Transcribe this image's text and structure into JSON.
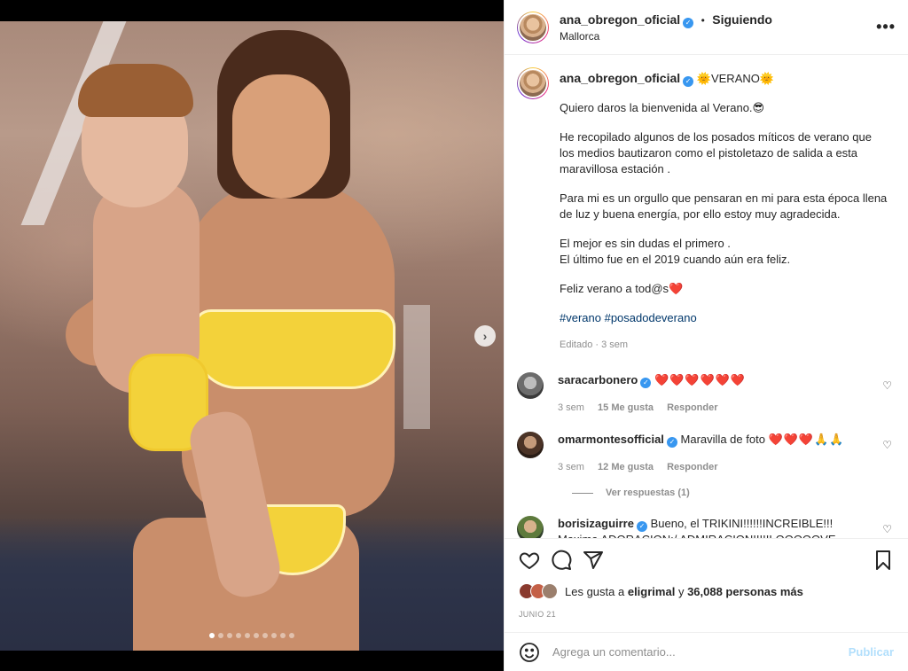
{
  "post": {
    "carousel_dots": 10,
    "active_dot": 0
  },
  "header": {
    "username": "ana_obregon_oficial",
    "separator": "•",
    "follow_status": "Siguiendo",
    "location": "Mallorca",
    "more_icon": "more-horizontal-icon"
  },
  "caption": {
    "username": "ana_obregon_oficial",
    "title": "🌞VERANO🌞",
    "paragraph_1": "Quiero daros la bienvenida al Verano.😎",
    "paragraph_2": "He recopilado algunos de los posados míticos de verano que los medios bautizaron como el pistoletazo de salida a esta maravillosa estación .",
    "paragraph_3": "Para mi es un orgullo que pensaran en mi para esta época llena de luz y buena energía, por ello estoy muy agradecida.",
    "paragraph_4a": "El mejor es sin dudas el primero .",
    "paragraph_4b": "El último fue en el 2019 cuando aún era feliz.",
    "paragraph_5": "Feliz verano a tod@s❤️",
    "hashtags": "#verano #posadodeverano",
    "meta": "Editado · 3 sem"
  },
  "comments": [
    {
      "username": "saracarbonero",
      "text": "❤️❤️❤️❤️❤️❤️",
      "age": "3 sem",
      "likes": "15 Me gusta",
      "reply": "Responder"
    },
    {
      "username": "omarmontesofficial",
      "text": "Maravilla de foto",
      "emoji": "❤️❤️❤️🙏🙏",
      "age": "3 sem",
      "likes": "12 Me gusta",
      "reply": "Responder",
      "view_replies": "Ver respuestas (1)"
    },
    {
      "username": "borisizaguirre",
      "text": "Bueno, el TRIKINI!!!!!!INCREIBLE!!! Maxima ADORACION:/ ADMIRACION!!!!!LOOOOOVE BORIS"
    }
  ],
  "actions": {
    "likes_prefix": "Les gusta a",
    "likes_user": "eligrimal",
    "likes_connector": "y",
    "likes_count": "36,088 personas más",
    "date": "JUNIO 21"
  },
  "composer": {
    "placeholder": "Agrega un comentario...",
    "publish_label": "Publicar"
  }
}
